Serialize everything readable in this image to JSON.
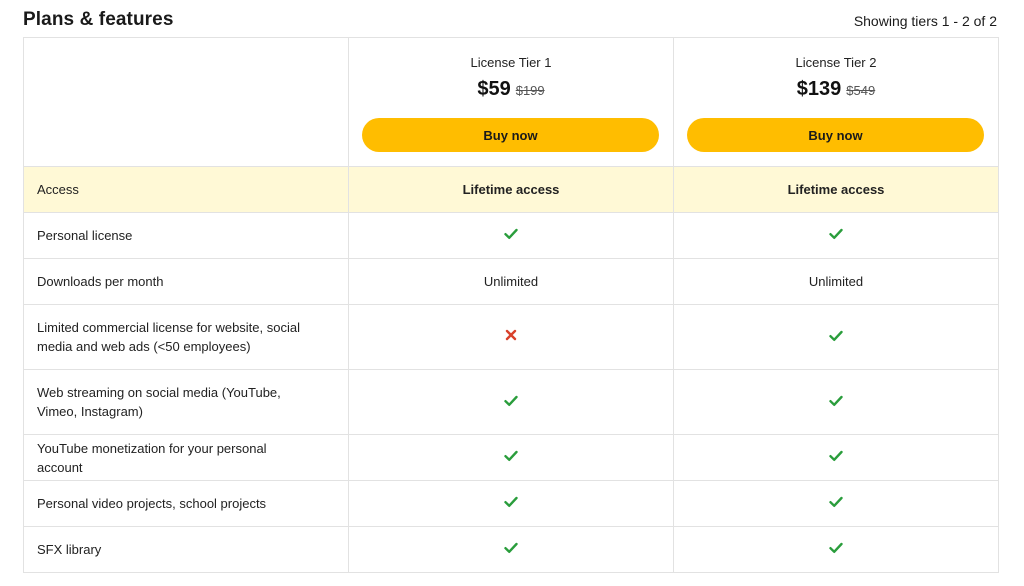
{
  "header": {
    "title": "Plans & features",
    "tier_count": "Showing tiers 1 - 2 of 2"
  },
  "tiers": [
    {
      "name": "License Tier 1",
      "price": "$59",
      "old_price": "$199",
      "button_label": "Buy now"
    },
    {
      "name": "License Tier 2",
      "price": "$139",
      "old_price": "$549",
      "button_label": "Buy now"
    }
  ],
  "features": [
    {
      "label": "Access",
      "values": [
        "Lifetime access",
        "Lifetime access"
      ]
    },
    {
      "label": "Personal license",
      "values": [
        "check",
        "check"
      ]
    },
    {
      "label": "Downloads per month",
      "values": [
        "Unlimited",
        "Unlimited"
      ]
    },
    {
      "label": "Limited commercial license for website, social media and web ads (<50 employees)",
      "values": [
        "cross",
        "check"
      ]
    },
    {
      "label": "Web streaming on social media (YouTube, Vimeo, Instagram)",
      "values": [
        "check",
        "check"
      ]
    },
    {
      "label": "YouTube monetization for your personal account",
      "values": [
        "check",
        "check"
      ]
    },
    {
      "label": "Personal video projects, school projects",
      "values": [
        "check",
        "check"
      ]
    },
    {
      "label": "SFX library",
      "values": [
        "check",
        "check"
      ]
    }
  ],
  "icons": {
    "check": "check-icon",
    "cross": "cross-icon"
  },
  "colors": {
    "accent": "#ffbd00",
    "highlight_row": "#fff9d6",
    "check": "#2a9d3c",
    "cross": "#d9412b"
  }
}
